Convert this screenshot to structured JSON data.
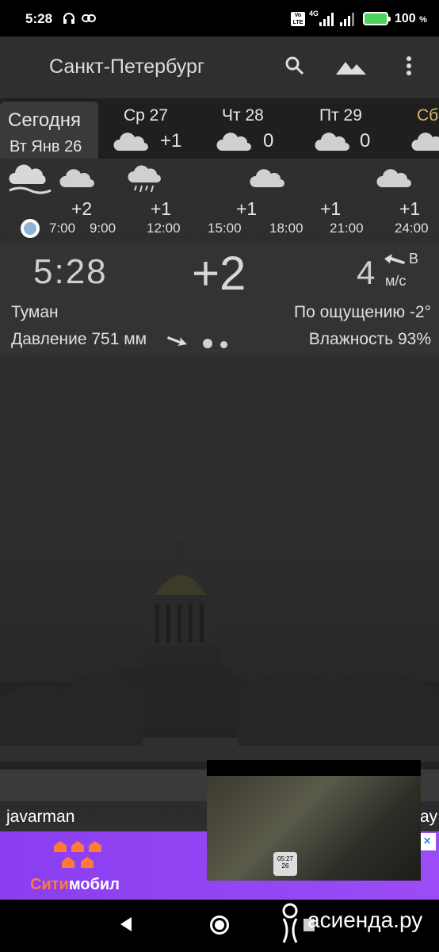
{
  "status_bar": {
    "time": "5:28",
    "network": "4G",
    "volte": "Vo LTE",
    "battery_percent": "100",
    "battery_unit": "%",
    "battery_color": "#4cd35a"
  },
  "toolbar": {
    "city": "Санкт-Петербург",
    "icons": [
      "search-icon",
      "landscape-icon",
      "more-vert-icon"
    ]
  },
  "days": {
    "today": {
      "label": "Сегодня",
      "date": "Вт Янв 26"
    },
    "items": [
      {
        "day": "Ср 27",
        "temp": "+1",
        "icon": "cloud-icon"
      },
      {
        "day": "Чт 28",
        "temp": "0",
        "icon": "cloud-icon"
      },
      {
        "day": "Пт 29",
        "temp": "0",
        "icon": "cloud-icon"
      },
      {
        "day": "Сб",
        "temp": "",
        "icon": "cloud-icon"
      }
    ]
  },
  "hourly": {
    "temps": [
      "+2",
      "+1",
      "+1",
      "+1",
      "+1"
    ],
    "times": [
      "7:00",
      "9:00",
      "12:00",
      "15:00",
      "18:00",
      "21:00",
      "24:00"
    ],
    "icons": [
      "fog-icon",
      "cloud-icon",
      "rain-cloud-icon",
      "cloud-icon",
      "cloud-icon"
    ]
  },
  "current": {
    "time": "5:28",
    "temp": "+2",
    "wind_speed": "4",
    "wind_dir": "В",
    "wind_unit": "м/с",
    "condition": "Туман",
    "feels_like": "По ощущению -2°",
    "pressure": "Давление 751 мм",
    "humidity": "Влажность 93%"
  },
  "ad": {
    "username": "javarman",
    "username_right": "ay",
    "brand_a": "Сити",
    "brand_b": "мобил",
    "close": "×",
    "video_time": "05:27",
    "video_date": "26"
  },
  "watermark": "асиенда.ру"
}
